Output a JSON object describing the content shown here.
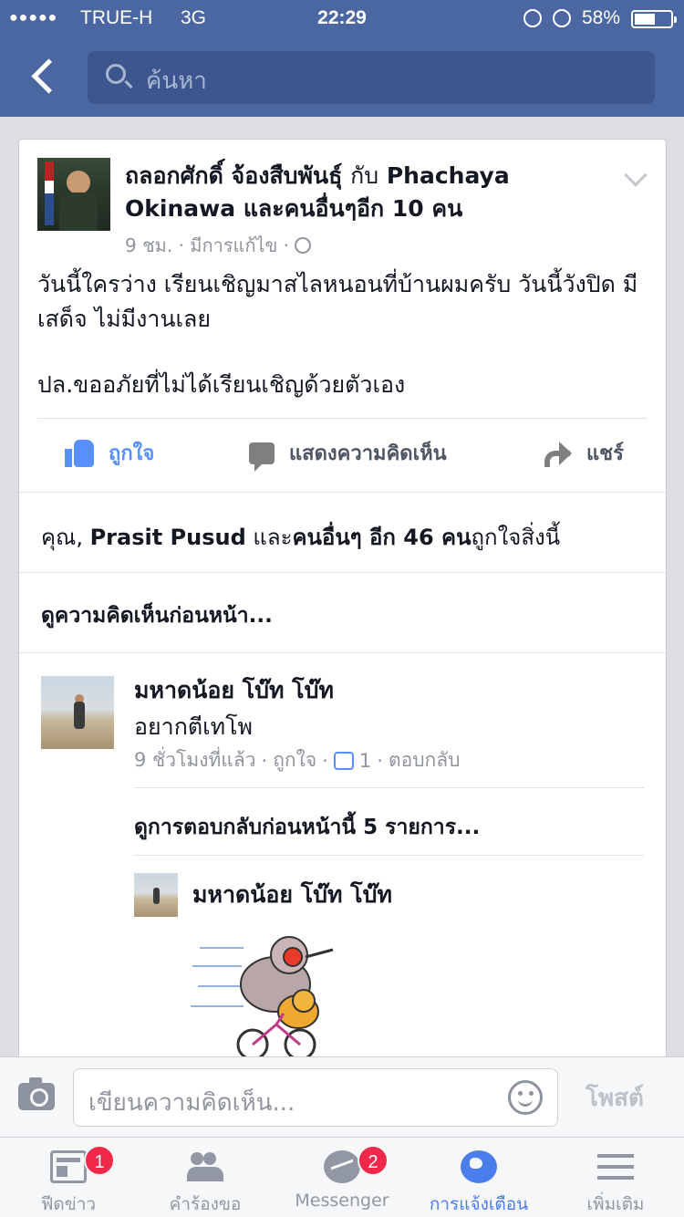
{
  "status_bar": {
    "signal": "●●●●●",
    "carrier": "TRUE-H",
    "network": "3G",
    "time": "22:29",
    "battery": "58%",
    "battery_level": 0.58
  },
  "nav": {
    "search_placeholder": "ค้นหา"
  },
  "post": {
    "author": "ถลอกศักดิ์ จ้องสืบพันธุ์",
    "with_word": "กับ",
    "tagged": "Phachaya Okinawa",
    "others": "และคนอื่นๆอีก 10 คน",
    "time": "9 ชม.",
    "edited": "มีการแก้ไข",
    "text_lines": [
      "วันนี้ใครว่าง เรียนเชิญมาสไลหนอนที่บ้านผมครับ วันนี้วังปิด มีเสด็จ ไม่มีงานเลย",
      "ปล.ขออภัยที่ไม่ได้เรียนเชิญด้วยตัวเอง"
    ],
    "actions": {
      "like": "ถูกใจ",
      "comment": "แสดงความคิดเห็น",
      "share": "แชร์"
    },
    "likes_summary": {
      "prefix": "คุณ, ",
      "name": "Prasit Pusud",
      "middle": " และ",
      "others": "คนอื่นๆ อีก 46 คน",
      "suffix": "ถูกใจสิ่งนี้"
    },
    "previous_comments": "ดูความคิดเห็นก่อนหน้า..."
  },
  "comment": {
    "name": "มหาดน้อย โบ๊ท โบ๊ท",
    "text": "อยากตีเทโพ",
    "time": "9 ชั่วโมงที่แล้ว",
    "like": "ถูกใจ",
    "like_count": "1",
    "reply": "ตอบกลับ",
    "previous_replies": "ดูการตอบกลับก่อนหน้านี้ 5 รายการ...",
    "reply_item": {
      "name": "มหาดน้อย โบ๊ท โบ๊ท"
    }
  },
  "composer": {
    "placeholder": "เขียนความคิดเห็น...",
    "post_label": "โพสต์"
  },
  "tabbar": {
    "tabs": [
      {
        "label": "ฟีดข่าว",
        "badge": "1",
        "icon": "news-feed-icon"
      },
      {
        "label": "คำร้องขอ",
        "badge": "",
        "icon": "friend-requests-icon"
      },
      {
        "label": "Messenger",
        "badge": "2",
        "icon": "messenger-icon"
      },
      {
        "label": "การแจ้งเตือน",
        "badge": "",
        "icon": "globe-icon"
      },
      {
        "label": "เพิ่มเติม",
        "badge": "",
        "icon": "menu-icon"
      }
    ],
    "active_color": "#4b7ded"
  },
  "colors": {
    "header": "#4b67a1",
    "link_blue": "#5890ff",
    "badge_red": "#f02849"
  }
}
